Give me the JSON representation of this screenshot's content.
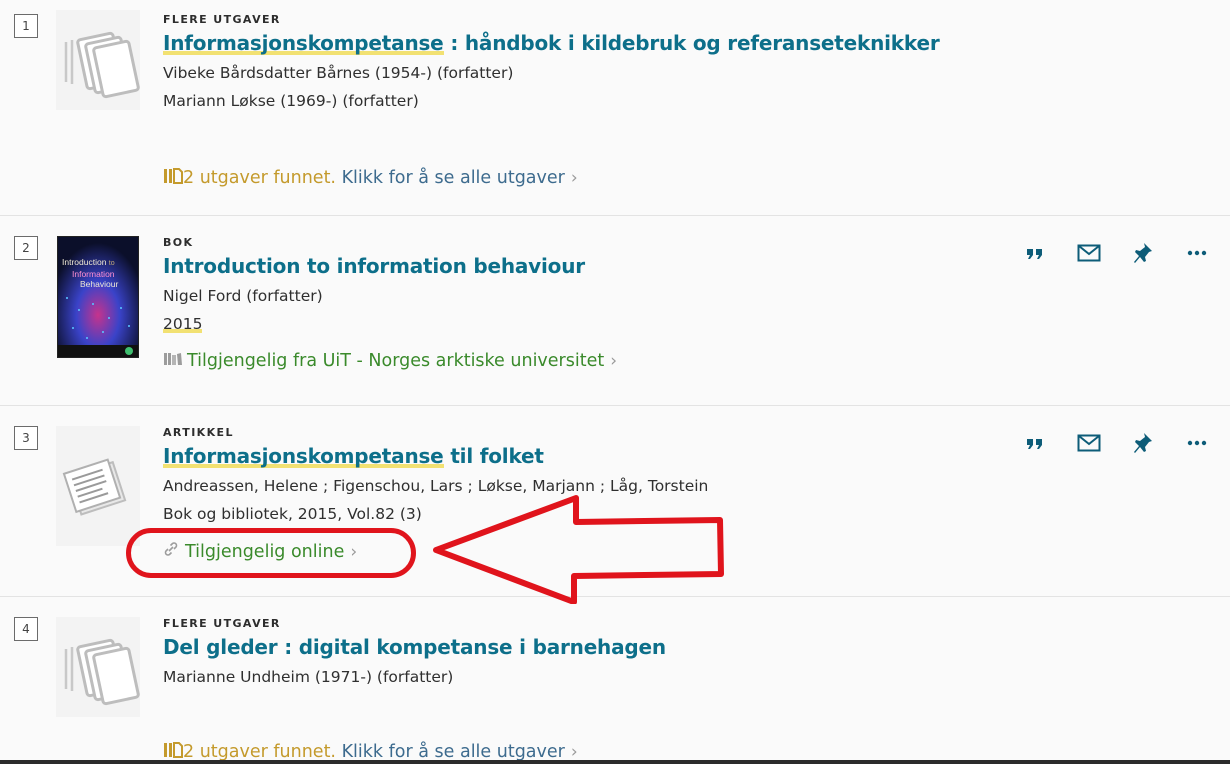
{
  "results": [
    {
      "number": "1",
      "type": "FLERE UTGAVER",
      "title_hl": "Informasjonskompetanse",
      "title_rest": " : håndbok i kildebruk og referanseteknikker",
      "lines": [
        "Vibeke Bårdsdatter Bårnes (1954-) (forfatter)",
        "Mariann Løkse (1969-) (forfatter)"
      ],
      "avail_count": "2 utgaver funnet.",
      "avail_link": "Klikk for å se alle utgaver",
      "thumb_icon": "multiple-versions-icon"
    },
    {
      "number": "2",
      "type": "BOK",
      "title": "Introduction to information behaviour",
      "author": "Nigel Ford (forfatter)",
      "year": "2015",
      "cover_text_1": "Introduction",
      "cover_text_2": "to",
      "cover_text_3": "Information",
      "cover_text_4": "Behaviour",
      "avail": "Tilgjengelig fra UiT - Norges arktiske universitet",
      "avail_icon": "book-icon"
    },
    {
      "number": "3",
      "type": "ARTIKKEL",
      "title_hl": "Informasjonskompetanse",
      "title_rest": " til folket",
      "authors": "Andreassen, Helene ; Figenschou, Lars ; Løkse, Marjann ; Låg, Torstein",
      "source": "Bok og bibliotek, 2015, Vol.82 (3)",
      "avail": "Tilgjengelig online",
      "avail_icon": "link-icon",
      "thumb_icon": "article-icon"
    },
    {
      "number": "4",
      "type": "FLERE UTGAVER",
      "title": "Del gleder : digital kompetanse i barnehagen",
      "author": "Marianne Undheim (1971-) (forfatter)",
      "avail_count": "2 utgaver funnet.",
      "avail_link": "Klikk for å se alle utgaver",
      "thumb_icon": "multiple-versions-icon"
    }
  ],
  "actions": [
    "citation-icon",
    "email-icon",
    "pin-icon",
    "more-icon"
  ],
  "annotation": {
    "color": "#e0141c"
  },
  "colors": {
    "title": "#0d6f8a",
    "available": "#3a8a2b",
    "highlight": "#f2e172",
    "versions": "#c49a2c"
  }
}
